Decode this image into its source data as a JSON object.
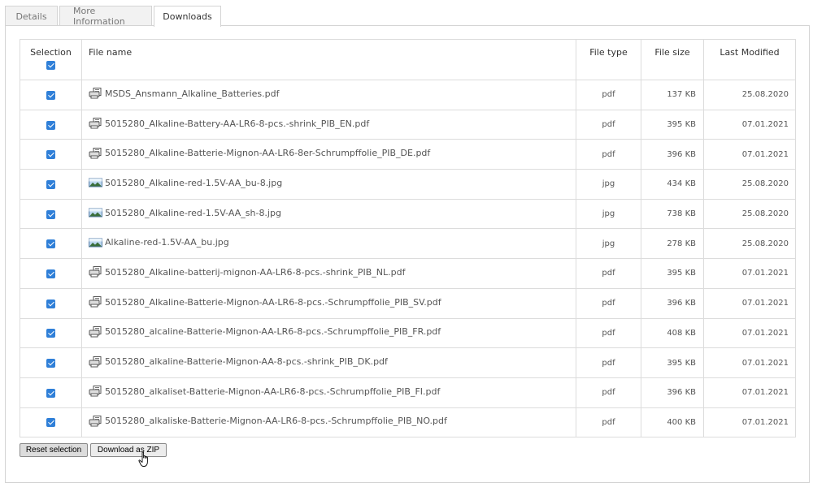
{
  "tabs": [
    {
      "label": "Details",
      "active": false
    },
    {
      "label": "More Information",
      "active": false
    },
    {
      "label": "Downloads",
      "active": true
    }
  ],
  "table": {
    "headers": {
      "selection": "Selection",
      "file_name": "File name",
      "file_type": "File type",
      "file_size": "File size",
      "last_modified": "Last Modified"
    },
    "select_all_checked": true,
    "rows": [
      {
        "checked": true,
        "icon": "pdf-document-icon",
        "name": "MSDS_Ansmann_Alkaline_Batteries.pdf",
        "type": "pdf",
        "size": "137 KB",
        "date": "25.08.2020"
      },
      {
        "checked": true,
        "icon": "pdf-document-icon",
        "name": "5015280_Alkaline-Battery-AA-LR6-8-pcs.-shrink_PIB_EN.pdf",
        "type": "pdf",
        "size": "395 KB",
        "date": "07.01.2021"
      },
      {
        "checked": true,
        "icon": "pdf-document-icon",
        "name": "5015280_Alkaline-Batterie-Mignon-AA-LR6-8er-Schrumpffolie_PIB_DE.pdf",
        "type": "pdf",
        "size": "396 KB",
        "date": "07.01.2021"
      },
      {
        "checked": true,
        "icon": "image-file-icon",
        "name": "5015280_Alkaline-red-1.5V-AA_bu-8.jpg",
        "type": "jpg",
        "size": "434 KB",
        "date": "25.08.2020"
      },
      {
        "checked": true,
        "icon": "image-file-icon",
        "name": "5015280_Alkaline-red-1.5V-AA_sh-8.jpg",
        "type": "jpg",
        "size": "738 KB",
        "date": "25.08.2020"
      },
      {
        "checked": true,
        "icon": "image-file-icon",
        "name": "Alkaline-red-1.5V-AA_bu.jpg",
        "type": "jpg",
        "size": "278 KB",
        "date": "25.08.2020"
      },
      {
        "checked": true,
        "icon": "pdf-document-icon",
        "name": "5015280_Alkaline-batterij-mignon-AA-LR6-8-pcs.-shrink_PIB_NL.pdf",
        "type": "pdf",
        "size": "395 KB",
        "date": "07.01.2021"
      },
      {
        "checked": true,
        "icon": "pdf-document-icon",
        "name": "5015280_Alkaline-Batterie-Mignon-AA-LR6-8-pcs.-Schrumpffolie_PIB_SV.pdf",
        "type": "pdf",
        "size": "396 KB",
        "date": "07.01.2021"
      },
      {
        "checked": true,
        "icon": "pdf-document-icon",
        "name": "5015280_alcaline-Batterie-Mignon-AA-LR6-8-pcs.-Schrumpffolie_PIB_FR.pdf",
        "type": "pdf",
        "size": "408 KB",
        "date": "07.01.2021"
      },
      {
        "checked": true,
        "icon": "pdf-document-icon",
        "name": "5015280_alkaline-Batterie-Mignon-AA-8-pcs.-shrink_PIB_DK.pdf",
        "type": "pdf",
        "size": "395 KB",
        "date": "07.01.2021"
      },
      {
        "checked": true,
        "icon": "pdf-document-icon",
        "name": "5015280_alkaliset-Batterie-Mignon-AA-LR6-8-pcs.-Schrumpffolie_PIB_FI.pdf",
        "type": "pdf",
        "size": "396 KB",
        "date": "07.01.2021"
      },
      {
        "checked": true,
        "icon": "pdf-document-icon",
        "name": "5015280_alkaliske-Batterie-Mignon-AA-LR6-8-pcs.-Schrumpffolie_PIB_NO.pdf",
        "type": "pdf",
        "size": "400 KB",
        "date": "07.01.2021"
      }
    ]
  },
  "buttons": {
    "reset_label": "Reset selection",
    "zip_label": "Download as ZIP"
  },
  "colors": {
    "checkbox": "#2f7fd8",
    "border": "#dcdcdc"
  }
}
